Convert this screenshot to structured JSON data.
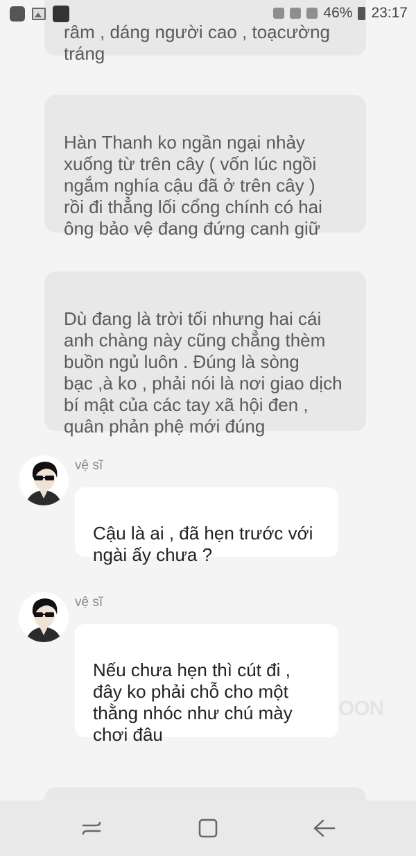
{
  "status_bar": {
    "battery": "46%",
    "time": "23:17"
  },
  "narrations": [
    {
      "text": "râm , dáng người cao , toạcường\ntráng"
    },
    {
      "text": "Hàn Thanh ko ngần ngại nhảy\nxuống từ trên cây ( vốn lúc ngồi\nngắm nghía cậu đã ở trên cây  )\nrồi đi thẳng lối cổng chính có hai\nông bảo vệ đang đứng canh giữ"
    },
    {
      "text": "Dù đang là trời tối nhưng hai cái\nanh chàng này cũng chẳng thèm\nbuồn ngủ luôn . Đúng là sòng\nbạc ,à ko , phải nói là nơi giao dịch\nbí mật của các tay xã hội đen ,\nquân phản phệ mới đúng"
    }
  ],
  "messages": [
    {
      "speaker": "vệ sĩ",
      "text": "Cậu là ai , đã hẹn trước với\nngài ấy chưa  ?"
    },
    {
      "speaker": "vệ sĩ",
      "text": "Nếu chưa hẹn thì cút đi ,\nđây ko phải chỗ cho một\nthằng nhóc như chú mày\nchơi đâu"
    }
  ],
  "watermark": "OON",
  "icons": {
    "status_left": [
      "notification-square-icon",
      "gallery-icon",
      "mangatoon-app-icon"
    ],
    "status_right": [
      "alarm-icon",
      "wifi-icon",
      "signal-icon",
      "battery-icon"
    ],
    "nav": [
      "recent-apps-icon",
      "home-icon",
      "back-icon"
    ]
  }
}
